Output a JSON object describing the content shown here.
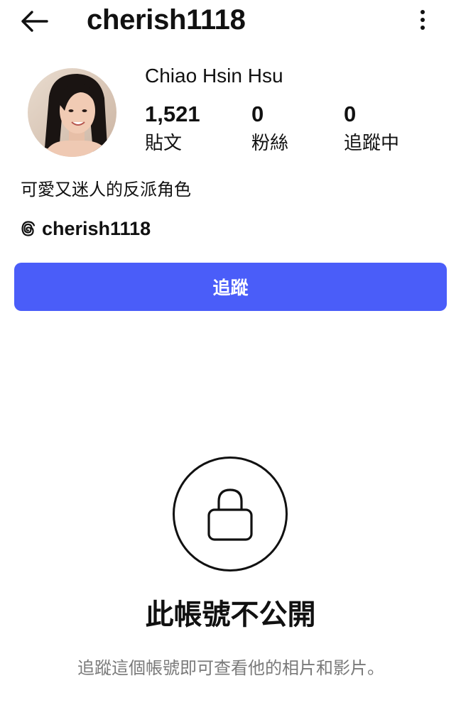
{
  "header": {
    "username": "cherish1118",
    "back_icon": "arrow-left-icon",
    "more_icon": "more-vertical-icon"
  },
  "profile": {
    "display_name": "Chiao Hsin Hsu",
    "avatar": "profile-photo",
    "stats": {
      "posts_count": "1,521",
      "posts_label": "貼文",
      "followers_count": "0",
      "followers_label": "粉絲",
      "following_count": "0",
      "following_label": "追蹤中"
    },
    "bio": "可愛又迷人的反派角色",
    "threads_handle": "cherish1118",
    "threads_icon": "threads-icon"
  },
  "actions": {
    "follow_label": "追蹤"
  },
  "private_notice": {
    "icon": "lock-icon",
    "title": "此帳號不公開",
    "description": "追蹤這個帳號即可查看他的相片和影片。"
  },
  "colors": {
    "accent": "#4a5df9",
    "text": "#111111",
    "muted": "#7a7a7a"
  }
}
